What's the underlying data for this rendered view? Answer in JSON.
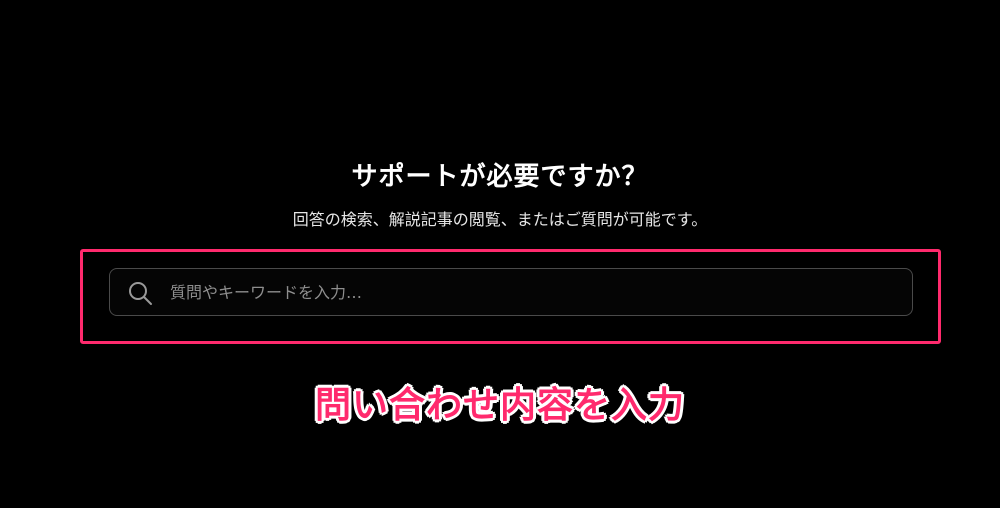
{
  "support": {
    "title": "サポートが必要ですか？",
    "subtitle": "回答の検索、解説記事の閲覧、またはご質問が可能です。",
    "search": {
      "placeholder": "質問やキーワードを入力…",
      "value": "",
      "icon": "search-icon"
    }
  },
  "annotation": {
    "label": "問い合わせ内容を入力",
    "color": "#ff2a6d",
    "outline_color": "#ffffff"
  }
}
